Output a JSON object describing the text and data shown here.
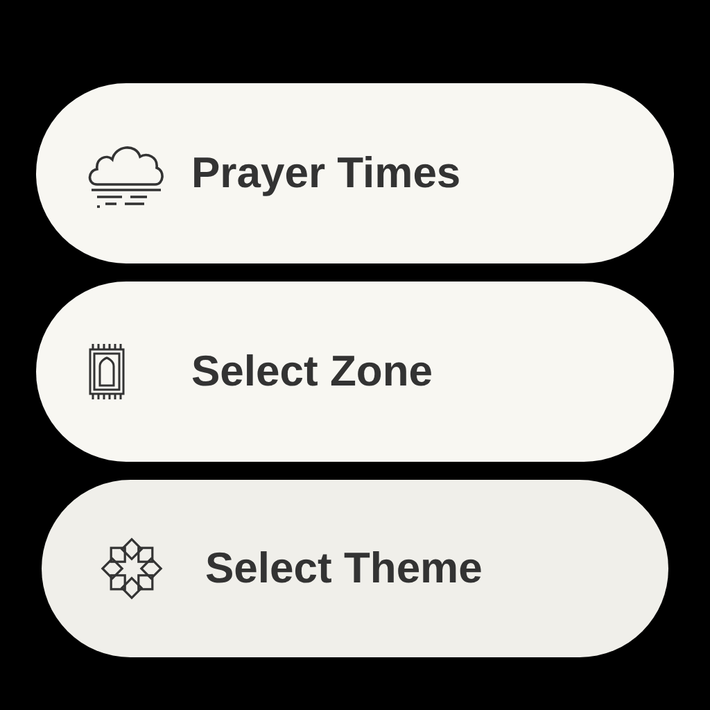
{
  "menu": [
    {
      "label": "Prayer Times",
      "pressed": false
    },
    {
      "label": "Select Zone",
      "pressed": false
    },
    {
      "label": "Select Theme",
      "pressed": true
    }
  ]
}
